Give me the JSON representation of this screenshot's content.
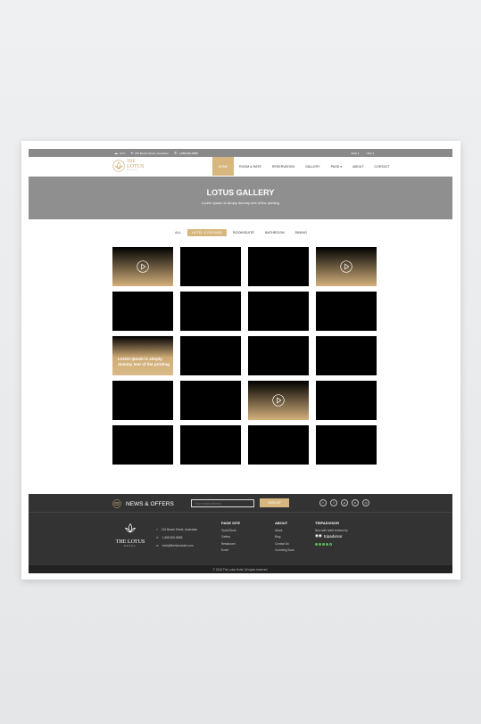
{
  "topbar": {
    "weather": "16°C",
    "address": "215 Beach Street, Australian",
    "phone": "1-888-800-8888",
    "lang": "ENG ▾",
    "currency": "USD ▾"
  },
  "logo": {
    "line1": "THE",
    "line2": "LOTUS",
    "line3": "HOTEL"
  },
  "nav": [
    {
      "label": "HOME",
      "active": true
    },
    {
      "label": "ROOM & RATE"
    },
    {
      "label": "RESERVATION"
    },
    {
      "label": "GALLERY"
    },
    {
      "label": "PAGE ▾"
    },
    {
      "label": "ABOUT"
    },
    {
      "label": "CONTACT"
    }
  ],
  "hero": {
    "title": "LOTUS GALLERY",
    "subtitle": "Lorem Ipsum is simply dummy text of the printing"
  },
  "filters": [
    {
      "label": "ALL"
    },
    {
      "label": "HOTEL & GROUND",
      "active": true
    },
    {
      "label": "ROOM/SUITE"
    },
    {
      "label": "BATHROOM"
    },
    {
      "label": "DINING"
    }
  ],
  "gallery": {
    "caption": "Lorem Ipsum is simply dummy text of the printing",
    "tiles": [
      "video",
      "plain",
      "plain",
      "video",
      "plain",
      "plain",
      "plain",
      "plain",
      "caption",
      "plain",
      "plain",
      "plain",
      "plain",
      "plain",
      "video",
      "plain",
      "plain",
      "plain",
      "plain",
      "plain"
    ]
  },
  "footer": {
    "news_title": "NEWS & OFFERS",
    "email_placeholder": "Your email address",
    "signup": "SIGN UP",
    "social_icons": [
      "twitter-icon",
      "facebook-icon",
      "pinterest-icon",
      "tripadvisor-icon",
      "instagram-icon"
    ],
    "logo_name": "THE LOTUS",
    "logo_sub": "HOTEL",
    "contact": {
      "address": "215 Beach Street, Australian",
      "phone": "1-888-800-8888",
      "email": "hello@thelotushotel.com"
    },
    "page_site": {
      "title": "PAGE SITE",
      "items": [
        "Guest Book",
        "Gallery",
        "Restaurant",
        "Event"
      ]
    },
    "about": {
      "title": "ABOUT",
      "items": [
        "About",
        "Blog",
        "Contact Us",
        "Comming Soon"
      ]
    },
    "tripadvisor": {
      "title": "TRIPADVISOR",
      "text": "Now with hotel reviews by",
      "brand": "tripadvisor",
      "rating": 4
    },
    "copyright": "© 2016 The Lotus Hotel. All rights reserved."
  },
  "colors": {
    "accent": "#d8b77f",
    "hero_bg": "#8f8f8f",
    "footer_bg": "#333333"
  }
}
